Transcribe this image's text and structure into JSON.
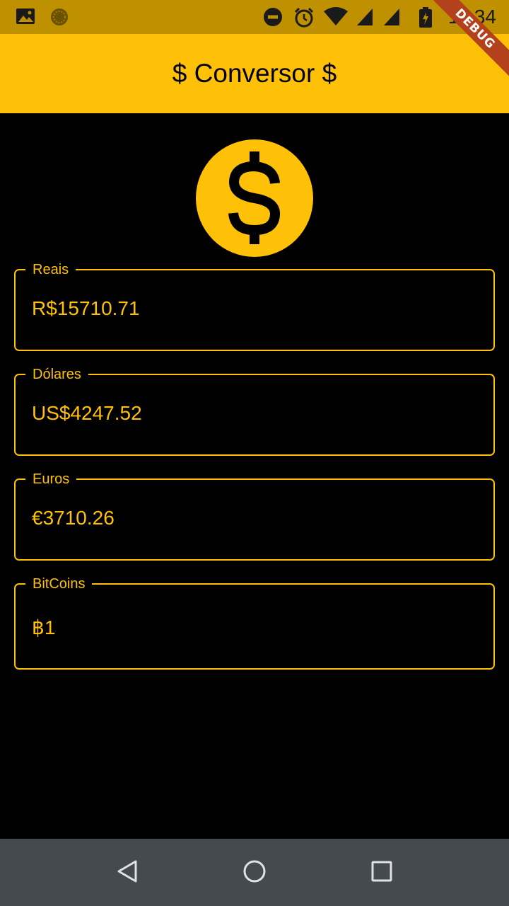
{
  "status_bar": {
    "time": "11:34",
    "icons": [
      "image-icon",
      "app-notification-icon",
      "do-not-disturb-icon",
      "alarm-icon",
      "wifi-icon",
      "signal-icon",
      "signal-icon-2",
      "battery-icon"
    ]
  },
  "debug_banner": "DEBUG",
  "app_bar": {
    "title": "$ Conversor $"
  },
  "logo": {
    "icon": "dollar-coin-icon",
    "color": "#ffc107"
  },
  "fields": {
    "reais": {
      "label": "Reais",
      "value": "R$15710.71"
    },
    "dolares": {
      "label": "Dólares",
      "value": "US$4247.52"
    },
    "euros": {
      "label": "Euros",
      "value": "€3710.26"
    },
    "bitcoins": {
      "label": "BitCoins",
      "value": "฿1"
    }
  },
  "nav_bar": {
    "buttons": [
      "back-icon",
      "home-icon",
      "recents-icon"
    ]
  },
  "colors": {
    "accent": "#ffc107",
    "status_bar": "#bf9000",
    "background": "#000000",
    "nav_bar": "#454a51",
    "debug_ribbon": "#b3411c"
  }
}
